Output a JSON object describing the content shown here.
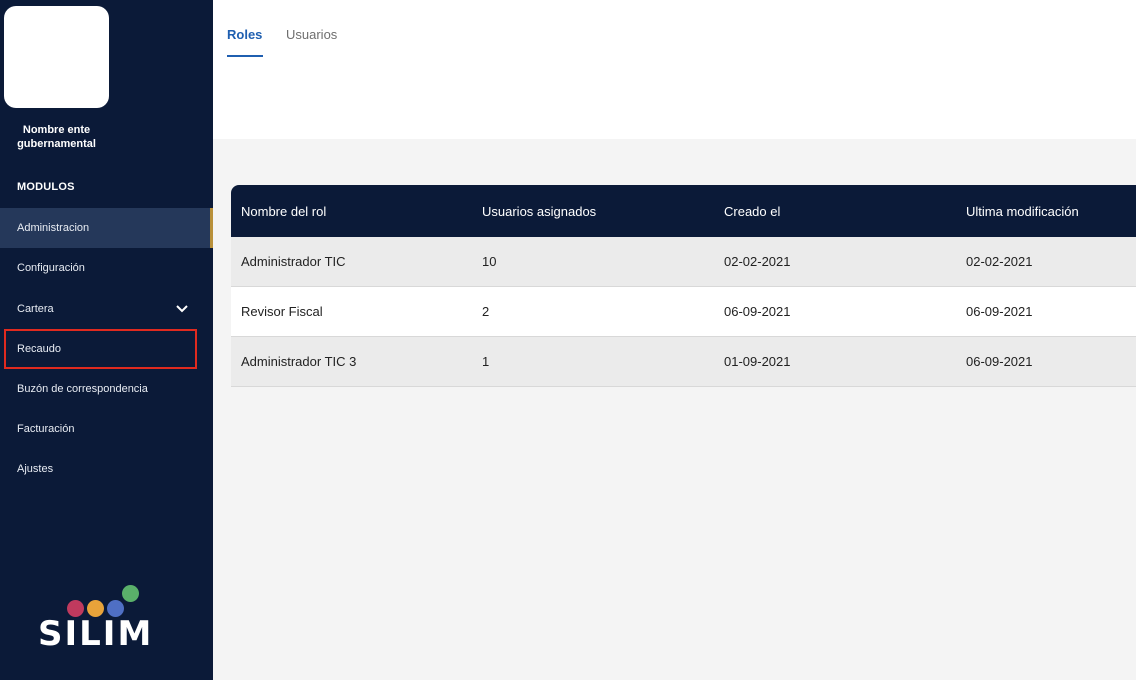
{
  "sidebar": {
    "entity_name_line1": "Nombre ente",
    "entity_name_line2": "gubernamental",
    "modules_heading": "MODULOS",
    "items": [
      {
        "label": "Administracion",
        "active": true
      },
      {
        "label": "Configuración"
      },
      {
        "label": "Cartera",
        "expandable": true
      },
      {
        "label": "Recaudo",
        "highlighted": true
      },
      {
        "label": "Buzón de correspondencia"
      },
      {
        "label": "Facturación"
      },
      {
        "label": "Ajustes"
      }
    ],
    "brand": "SILIM",
    "brand_dot_colors": [
      "#c03a5e",
      "#e8a33a",
      "#4f6fc4",
      "#5ab06a"
    ]
  },
  "tabs": [
    {
      "label": "Roles",
      "active": true
    },
    {
      "label": "Usuarios"
    }
  ],
  "table": {
    "headers": [
      "Nombre del rol",
      "Usuarios asignados",
      "Creado el",
      "Ultima modificación"
    ],
    "rows": [
      [
        "Administrador TIC",
        "10",
        "02-02-2021",
        "02-02-2021"
      ],
      [
        "Revisor Fiscal",
        "2",
        "06-09-2021",
        "06-09-2021"
      ],
      [
        "Administrador TIC 3",
        "1",
        "01-09-2021",
        "06-09-2021"
      ]
    ]
  },
  "colors": {
    "sidebar_bg": "#0b1a38",
    "accent_blue": "#1f5fb0",
    "highlight_red": "#e02a1f"
  }
}
